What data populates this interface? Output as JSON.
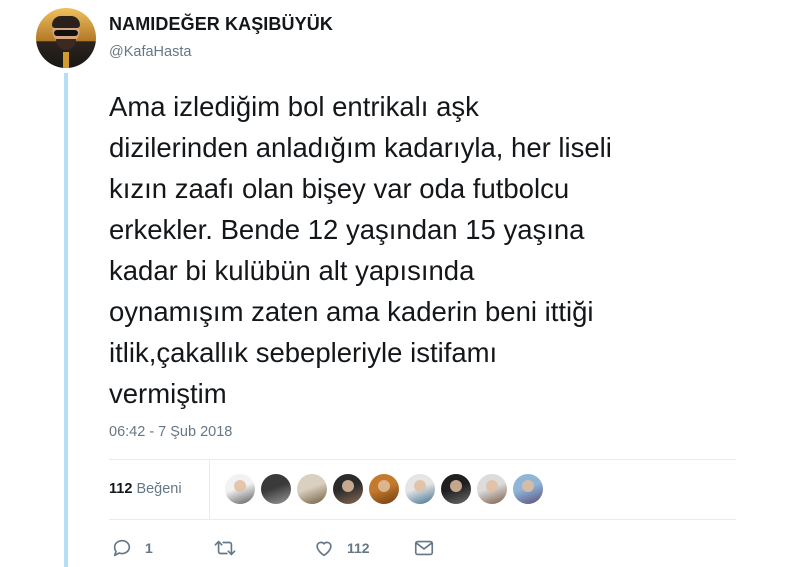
{
  "user": {
    "display_name": "NAMIDEĞER KAŞIBÜYÜK",
    "handle": "@KafaHasta",
    "avatar": "profile-photo"
  },
  "tweet": {
    "text": "Ama izlediğim bol entrikalı aşk\ndizilerinden anladığım kadarıyla, her liseli\nkızın zaafı olan bişey var oda futbolcu\nerkekler. Bende 12 yaşından 15 yaşına\nkadar bi kulübün alt yapısında\noynamışım zaten ama kaderin beni ittiği\nitlik,çakallık sebepleriyle istifamı\nvermiştim",
    "timestamp": "06:42 - 7 Şub 2018"
  },
  "stats": {
    "likes_count": "112",
    "likes_label": "Beğeni"
  },
  "likers": [
    {
      "name": "liker-avatar-1",
      "colors": [
        "#f2f2f2",
        "#5b5b5b"
      ]
    },
    {
      "name": "liker-avatar-2",
      "colors": [
        "#3a3a3a",
        "#9a9a9a"
      ]
    },
    {
      "name": "liker-avatar-3",
      "colors": [
        "#d9d0bf",
        "#6f5b3e"
      ]
    },
    {
      "name": "liker-avatar-4",
      "colors": [
        "#2b2b2b",
        "#8a6a52"
      ]
    },
    {
      "name": "liker-avatar-5",
      "colors": [
        "#c47a2c",
        "#6e3b12"
      ]
    },
    {
      "name": "liker-avatar-6",
      "colors": [
        "#e5e5e5",
        "#3d6f8f"
      ]
    },
    {
      "name": "liker-avatar-7",
      "colors": [
        "#1f1f1f",
        "#6d6d6d"
      ]
    },
    {
      "name": "liker-avatar-8",
      "colors": [
        "#dcdcdc",
        "#7a5a44"
      ]
    },
    {
      "name": "liker-avatar-9",
      "colors": [
        "#8fb6d8",
        "#5a4c7a"
      ]
    }
  ],
  "actions": {
    "reply_count": "1",
    "retweet_count": "",
    "like_count": "112"
  },
  "colors": {
    "thread_line": "#b4def6",
    "icon": "#657786",
    "text": "#14171a",
    "muted": "#657786"
  }
}
